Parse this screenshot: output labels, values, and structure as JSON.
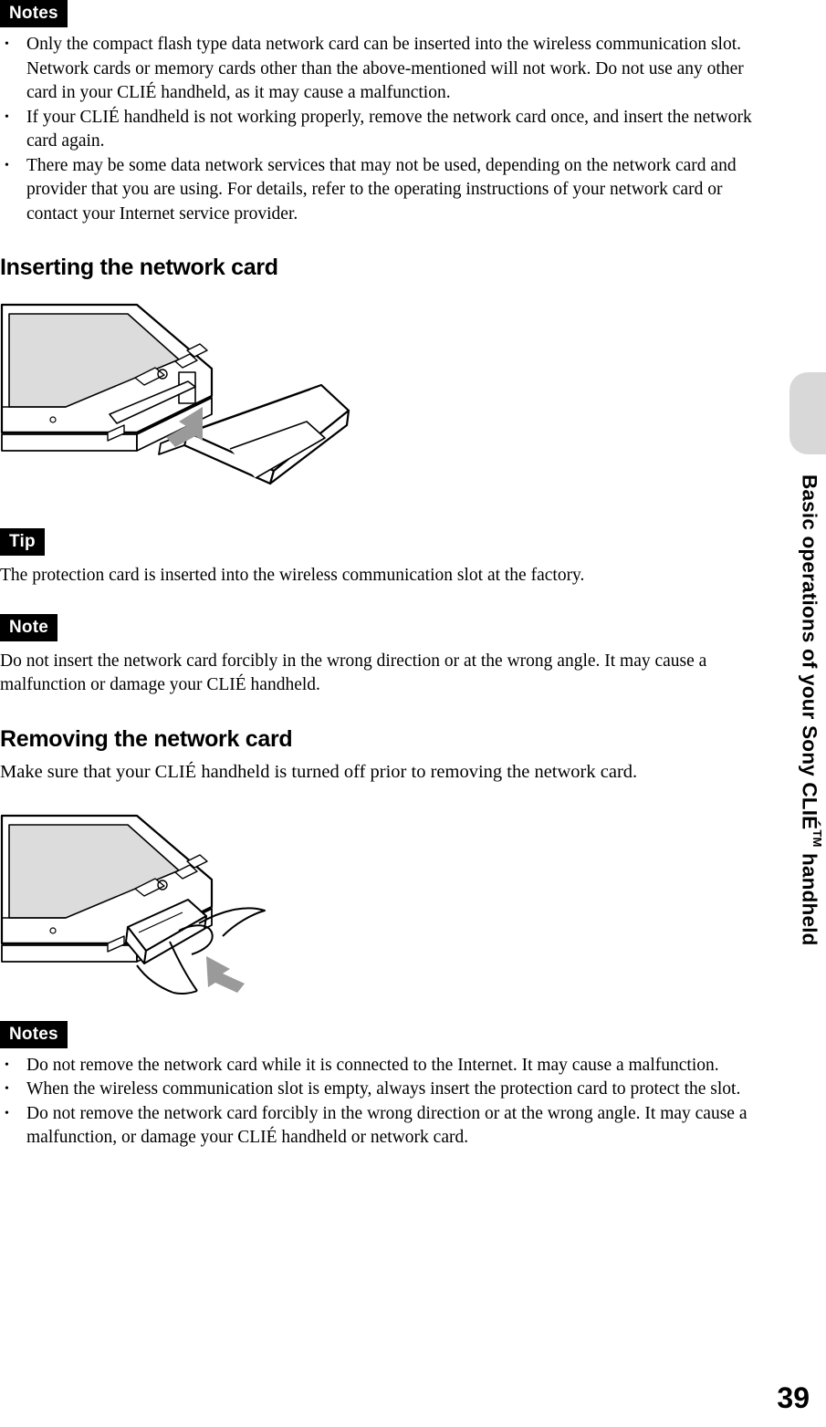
{
  "document": {
    "page_number": "39",
    "side_title_main": "Basic operations of your Sony CLIÉ",
    "side_title_tm": "TM",
    "side_title_tail": " handheld"
  },
  "blocks": {
    "notes_label_top": "Notes",
    "notes_top_items": [
      "Only the compact flash type data network card can be inserted into the wireless communication slot. Network cards or memory cards other than the above-mentioned will not work. Do not use any other card in your CLIÉ handheld, as it may cause a malfunction.",
      "If your CLIÉ handheld is not working properly, remove the network card once, and insert the network card again.",
      "There may be some data network services that may not be used, depending on the network card and provider that you are using. For details, refer to the operating instructions of your network card or contact your Internet service provider."
    ],
    "heading_inserting": "Inserting the network card",
    "tip_label": "Tip",
    "tip_text": "The protection card is inserted into the wireless communication slot at the factory.",
    "note_label": "Note",
    "note_text": "Do not insert the network card forcibly in the wrong direction or at the wrong angle. It may cause a malfunction or damage your CLIÉ handheld.",
    "heading_removing": "Removing the network card",
    "removing_text": "Make sure that your CLIÉ handheld is turned off prior to removing the network card.",
    "notes_label_bottom": "Notes",
    "notes_bottom_items": [
      "Do not remove the network card while it is connected to the Internet. It may cause a malfunction.",
      "When the wireless communication slot is empty, always insert the protection card to protect the slot.",
      "Do not remove the network card forcibly in the wrong direction or at the wrong angle. It may cause a malfunction, or damage your CLIÉ handheld or network card."
    ],
    "bullet_glyph": "•"
  },
  "figures": {
    "insert_figure_alt": "clie-handheld-inserting-network-card-illustration",
    "remove_figure_alt": "clie-handheld-removing-network-card-illustration"
  },
  "colors": {
    "label_background": "#000000",
    "label_text": "#ffffff",
    "side_tab": "#d8d8d8",
    "screen_fill": "#dcdcdc"
  }
}
